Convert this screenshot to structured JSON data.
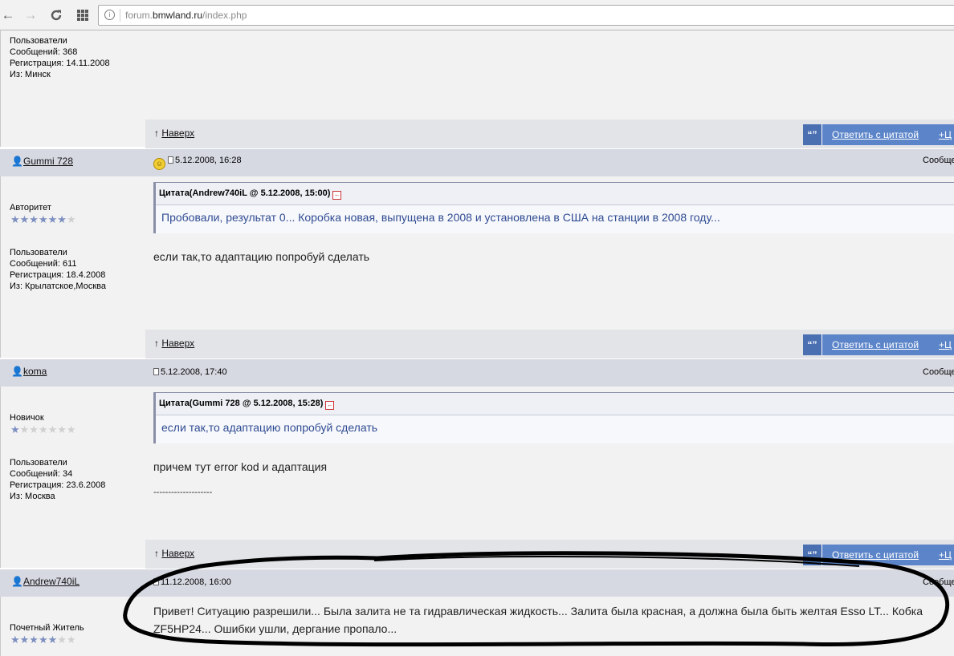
{
  "browser": {
    "url_host_prefix": "forum.",
    "url_host_main": "bmwland.ru",
    "url_path": "/index.php",
    "icons": [
      "back-icon",
      "forward-icon",
      "reload-icon",
      "apps-icon",
      "site-info-icon"
    ]
  },
  "labels": {
    "to_top": "Наверх",
    "reply_with_quote": "Ответить с цитатой",
    "plus_button": "+Ц",
    "message_column": "Сообще",
    "quote_icon": "“”"
  },
  "posts": [
    {
      "group": "Пользователи",
      "messages": "Сообщений: 368",
      "registered": "Регистрация: 14.11.2008",
      "from": "Из: Минск"
    },
    {
      "author": "Gummi 728",
      "date": "5.12.2008, 16:28",
      "rank": "Авторитет",
      "stars_filled": 6,
      "stars_total": 7,
      "group": "Пользователи",
      "messages": "Сообщений: 611",
      "registered": "Регистрация: 18.4.2008",
      "from": "Из: Крылатское,Москва",
      "quote_header": "Цитата(Andrew740iL @ 5.12.2008, 15:00)",
      "quote_text": "Пробовали, результат 0... Коробка новая, выпущена в 2008 и установлена в США на станции в 2008 году...",
      "text": "если так,то адаптацию попробуй сделать"
    },
    {
      "author": "koma",
      "date": "5.12.2008, 17:40",
      "rank": "Новичок",
      "stars_filled": 1,
      "stars_total": 7,
      "group": "Пользователи",
      "messages": "Сообщений: 34",
      "registered": "Регистрация: 23.6.2008",
      "from": "Из: Москва",
      "quote_header": "Цитата(Gummi 728 @ 5.12.2008, 15:28)",
      "quote_text": "если так,то адаптацию попробуй сделать",
      "text": "причем тут error kod и адаптация",
      "signature_sep": "--------------------"
    },
    {
      "author": "Andrew740iL",
      "date": "11.12.2008, 16:00",
      "rank": "Почетный Житель",
      "stars_filled": 5,
      "stars_total": 7,
      "text_line1": "Привет! Ситуацию разрешили... Была залита не та гидравлическая жидкость... Залита была красная, а должна была быть желтая Esso LT... Кобка",
      "text_line2": "ZF5HP24... Ошибки ушли, дергание пропало..."
    }
  ],
  "colors": {
    "bar": "#d7d9e2",
    "panel": "#f2f2f2",
    "button": "#5b84c9",
    "quote_text": "#2f4b93",
    "annotation": "#000000"
  }
}
